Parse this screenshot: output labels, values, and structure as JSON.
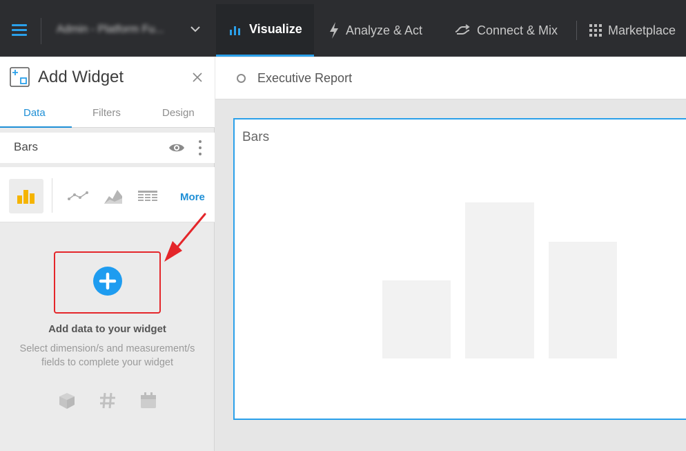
{
  "topbar": {
    "menu_icon": "hamburger-icon",
    "workspace": "Admin - Platform Fu...",
    "nav": [
      {
        "label": "Visualize",
        "icon": "bar-chart-icon",
        "active": true
      },
      {
        "label": "Analyze & Act",
        "icon": "lightning-icon",
        "active": false
      },
      {
        "label": "Connect & Mix",
        "icon": "connect-icon",
        "active": false
      },
      {
        "label": "Marketplace",
        "icon": "grid-icon",
        "active": false
      }
    ]
  },
  "panel": {
    "title": "Add Widget",
    "tabs": [
      "Data",
      "Filters",
      "Design"
    ],
    "active_tab": "Data",
    "widget_name": "Bars",
    "more_label": "More",
    "chart_types": [
      "bars",
      "line",
      "area",
      "table"
    ],
    "add_title": "Add data to your widget",
    "add_description": "Select dimension/s and measurement/s fields to complete your widget",
    "field_icons": [
      "cube-icon",
      "hash-icon",
      "calendar-icon"
    ]
  },
  "report": {
    "title": "Executive Report"
  },
  "canvas": {
    "widget_title": "Bars"
  },
  "colors": {
    "accent": "#2aa0ea",
    "topbar": "#2c2d30",
    "highlight": "#e4262a",
    "bar_icon": "#f5b400"
  }
}
